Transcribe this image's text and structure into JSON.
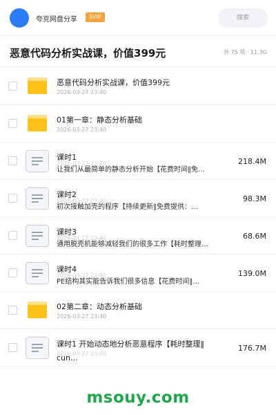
{
  "header": {
    "brand": "夸克网盘分享",
    "badge": "SVIP",
    "search_placeholder": "搜索"
  },
  "folder": {
    "title": "恶意代码分析实战课，价值399元",
    "meta": "共 75 项 · 11.3G"
  },
  "items": [
    {
      "type": "folder",
      "name": "恶意代码分析实战课，价值399元",
      "date": "2026-03-27 23:40"
    },
    {
      "type": "folder",
      "name": "01第一章：静态分析基础",
      "date": "2026-03-27 23:40"
    },
    {
      "type": "file",
      "name": "课时1",
      "desc": "让我们从最简单的静态分析开始【花费时间‖免…",
      "date": "2026-03-27 23:40",
      "size": "218.4M"
    },
    {
      "type": "file",
      "name": "课时2",
      "desc": "初次接触加壳的程序【持续更新‖免费提供：…",
      "date": "2026-03-27 23:40",
      "size": "98.3M"
    },
    {
      "type": "file",
      "name": "课时3",
      "desc": "通用脱壳机能够减轻我们的很多工作【耗时整理…",
      "date": "2026-03-27 23:40",
      "size": "68.6M"
    },
    {
      "type": "file",
      "name": "课时4",
      "desc": "PE结构其实能告诉我们很多信息【花费时间‖…",
      "date": "2026-03-27 23:40",
      "size": "139.0M"
    },
    {
      "type": "folder",
      "name": "02第二章：动态分析基础",
      "date": "2026-03-27 23:40"
    },
    {
      "type": "file2",
      "line1": "课时1 开始动态地分析恶意程序【耗时整理‖",
      "line2": "cun…",
      "date": "2026-03-27 23:40",
      "size": "176.7M"
    }
  ],
  "watermark": "msouy.com",
  "colors": {
    "accent": "#2b7cf6",
    "badge": "#f6a23a",
    "folder": "#ffc21a",
    "watermark": "#1fa64b"
  }
}
